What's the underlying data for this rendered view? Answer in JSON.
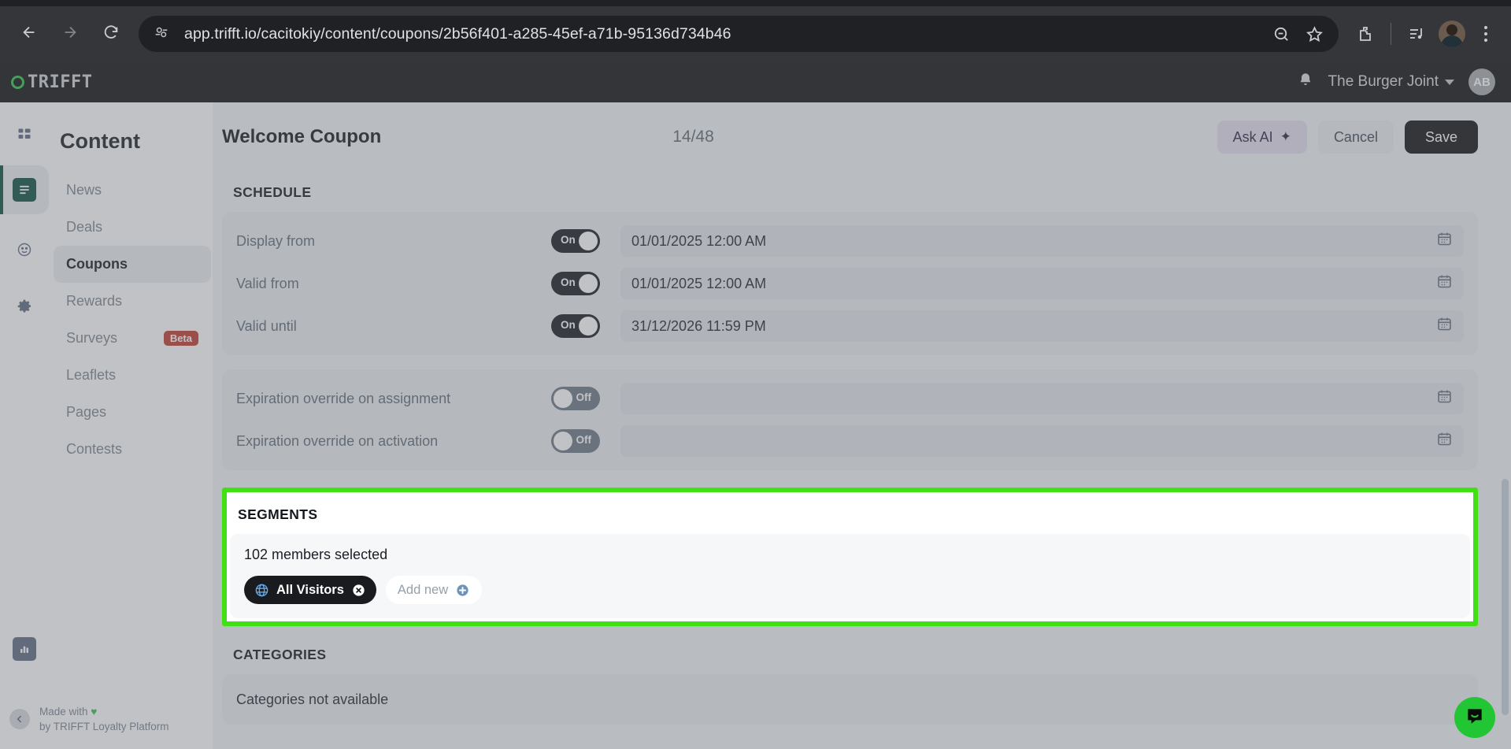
{
  "browser": {
    "url": "app.trifft.io/cacitokiy/content/coupons/2b56f401-a285-45ef-a71b-95136d734b46",
    "back_icon": "back-arrow-icon",
    "forward_icon": "forward-arrow-icon",
    "reload_icon": "reload-icon",
    "site_info_icon": "site-settings-icon",
    "zoom_out_icon": "zoom-out-icon",
    "bookmark_icon": "star-icon",
    "extensions_icon": "extensions-puzzle-icon",
    "media_icon": "media-playlist-icon",
    "profile_icon": "chrome-profile-avatar",
    "menu_icon": "chrome-kebab-menu-icon"
  },
  "app_header": {
    "brand": "TRIFFT",
    "notifications_icon": "bell-icon",
    "org_name": "The Burger Joint",
    "org_chevron_icon": "chevron-down-icon",
    "user_initials": "AB"
  },
  "sidebar": {
    "title": "Content",
    "rail": [
      {
        "name": "dashboard-icon"
      },
      {
        "name": "content-icon",
        "active": true
      },
      {
        "name": "smiley-icon"
      },
      {
        "name": "settings-gear-icon"
      },
      {
        "name": "analytics-bar-chart-icon"
      }
    ],
    "items": [
      {
        "label": "News",
        "active": false
      },
      {
        "label": "Deals",
        "active": false
      },
      {
        "label": "Coupons",
        "active": true
      },
      {
        "label": "Rewards",
        "active": false
      },
      {
        "label": "Surveys",
        "active": false,
        "badge": "Beta"
      },
      {
        "label": "Leaflets",
        "active": false
      },
      {
        "label": "Pages",
        "active": false
      },
      {
        "label": "Contests",
        "active": false
      }
    ],
    "collapse_icon": "chevron-left-icon",
    "footer_line1": "Made with",
    "footer_heart": "♥",
    "footer_line2": "by TRIFFT Loyalty Platform"
  },
  "page": {
    "title": "Welcome Coupon",
    "counter": "14/48",
    "ask_ai_label": "Ask AI",
    "ask_ai_icon": "sparkles-icon",
    "cancel_label": "Cancel",
    "save_label": "Save"
  },
  "schedule": {
    "title": "SCHEDULE",
    "rows": [
      {
        "label": "Display from",
        "toggle": "On",
        "toggle_on": true,
        "value": "01/01/2025 12:00 AM",
        "calendar_icon": "calendar-icon"
      },
      {
        "label": "Valid from",
        "toggle": "On",
        "toggle_on": true,
        "value": "01/01/2025 12:00 AM",
        "calendar_icon": "calendar-icon"
      },
      {
        "label": "Valid until",
        "toggle": "On",
        "toggle_on": true,
        "value": "31/12/2026 11:59 PM",
        "calendar_icon": "calendar-icon"
      }
    ],
    "override_rows": [
      {
        "label": "Expiration override on assignment",
        "toggle": "Off",
        "toggle_on": false,
        "value": "",
        "calendar_icon": "calendar-icon"
      },
      {
        "label": "Expiration override on activation",
        "toggle": "Off",
        "toggle_on": false,
        "value": "",
        "calendar_icon": "calendar-icon"
      }
    ]
  },
  "segments": {
    "title": "SEGMENTS",
    "members_selected": "102 members selected",
    "selected_chip": {
      "label": "All Visitors",
      "icon": "globe-icon",
      "remove_icon": "remove-x-icon"
    },
    "add_new_label": "Add new",
    "add_new_icon": "plus-circle-icon",
    "highlight_color": "#3fe014"
  },
  "categories": {
    "title": "CATEGORIES",
    "empty_text": "Categories not available"
  },
  "support": {
    "chat_icon": "intercom-chat-icon",
    "chat_color": "#22c533"
  }
}
